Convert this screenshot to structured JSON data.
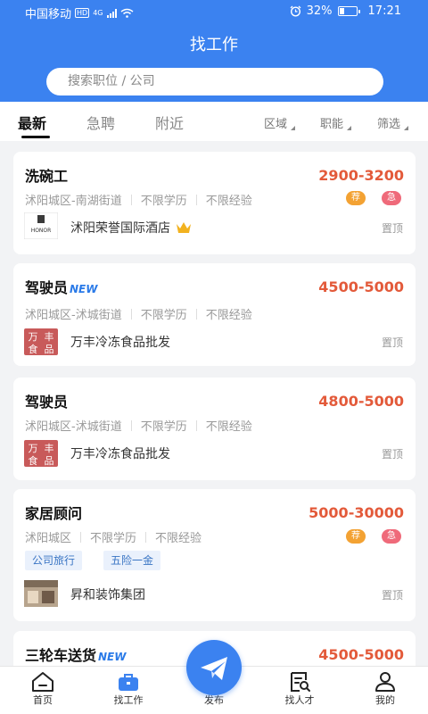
{
  "status_bar": {
    "carrier": "中国移动",
    "hd": "HD",
    "net": "4G",
    "battery_pct": "32%",
    "battery_level": 0.32,
    "time": "17:21"
  },
  "header": {
    "title": "找工作",
    "search_placeholder": "搜索职位 / 公司"
  },
  "tabs": [
    {
      "label": "最新"
    },
    {
      "label": "急聘"
    },
    {
      "label": "附近"
    }
  ],
  "filters": [
    {
      "label": "区域"
    },
    {
      "label": "职能"
    },
    {
      "label": "筛选"
    }
  ],
  "jobs": [
    {
      "title": "洗碗工",
      "salary": "2900-3200",
      "location": "沭阳城区-南湖街道",
      "education": "不限学历",
      "experience": "不限经验",
      "badges": [
        "荐",
        "急"
      ],
      "company": "沭阳荣誉国际酒店",
      "pin": "置顶",
      "logo": "HONOR"
    },
    {
      "title": "驾驶员",
      "new": "NEW",
      "salary": "4500-5000",
      "location": "沭阳城区-沭城街道",
      "education": "不限学历",
      "experience": "不限经验",
      "company": "万丰冷冻食品批发",
      "pin": "置顶",
      "logo": [
        "万",
        "丰",
        "食",
        "品"
      ]
    },
    {
      "title": "驾驶员",
      "salary": "4800-5000",
      "location": "沭阳城区-沭城街道",
      "education": "不限学历",
      "experience": "不限经验",
      "company": "万丰冷冻食品批发",
      "pin": "置顶",
      "logo": [
        "万",
        "丰",
        "食",
        "品"
      ]
    },
    {
      "title": "家居顾问",
      "salary": "5000-30000",
      "location": "沭阳城区",
      "education": "不限学历",
      "experience": "不限经验",
      "badges": [
        "荐",
        "急"
      ],
      "benefits": [
        "公司旅行",
        "五险一金"
      ],
      "company": "昇和装饰集团",
      "pin": "置顶"
    },
    {
      "title": "三轮车送货",
      "new": "NEW",
      "salary": "4500-5000"
    }
  ],
  "bottom_nav": [
    {
      "label": "首页",
      "icon": "home-icon"
    },
    {
      "label": "找工作",
      "icon": "briefcase-icon"
    },
    {
      "label": "发布",
      "icon": "paper-plane-icon"
    },
    {
      "label": "找人才",
      "icon": "talent-search-icon"
    },
    {
      "label": "我的",
      "icon": "profile-icon"
    }
  ],
  "colors": {
    "brand": "#3b82f0",
    "salary": "#e35a3a",
    "new_tag": "#2a7ae8",
    "badge_recommend": "#f3a233",
    "badge_urgent": "#ef6a7a"
  }
}
